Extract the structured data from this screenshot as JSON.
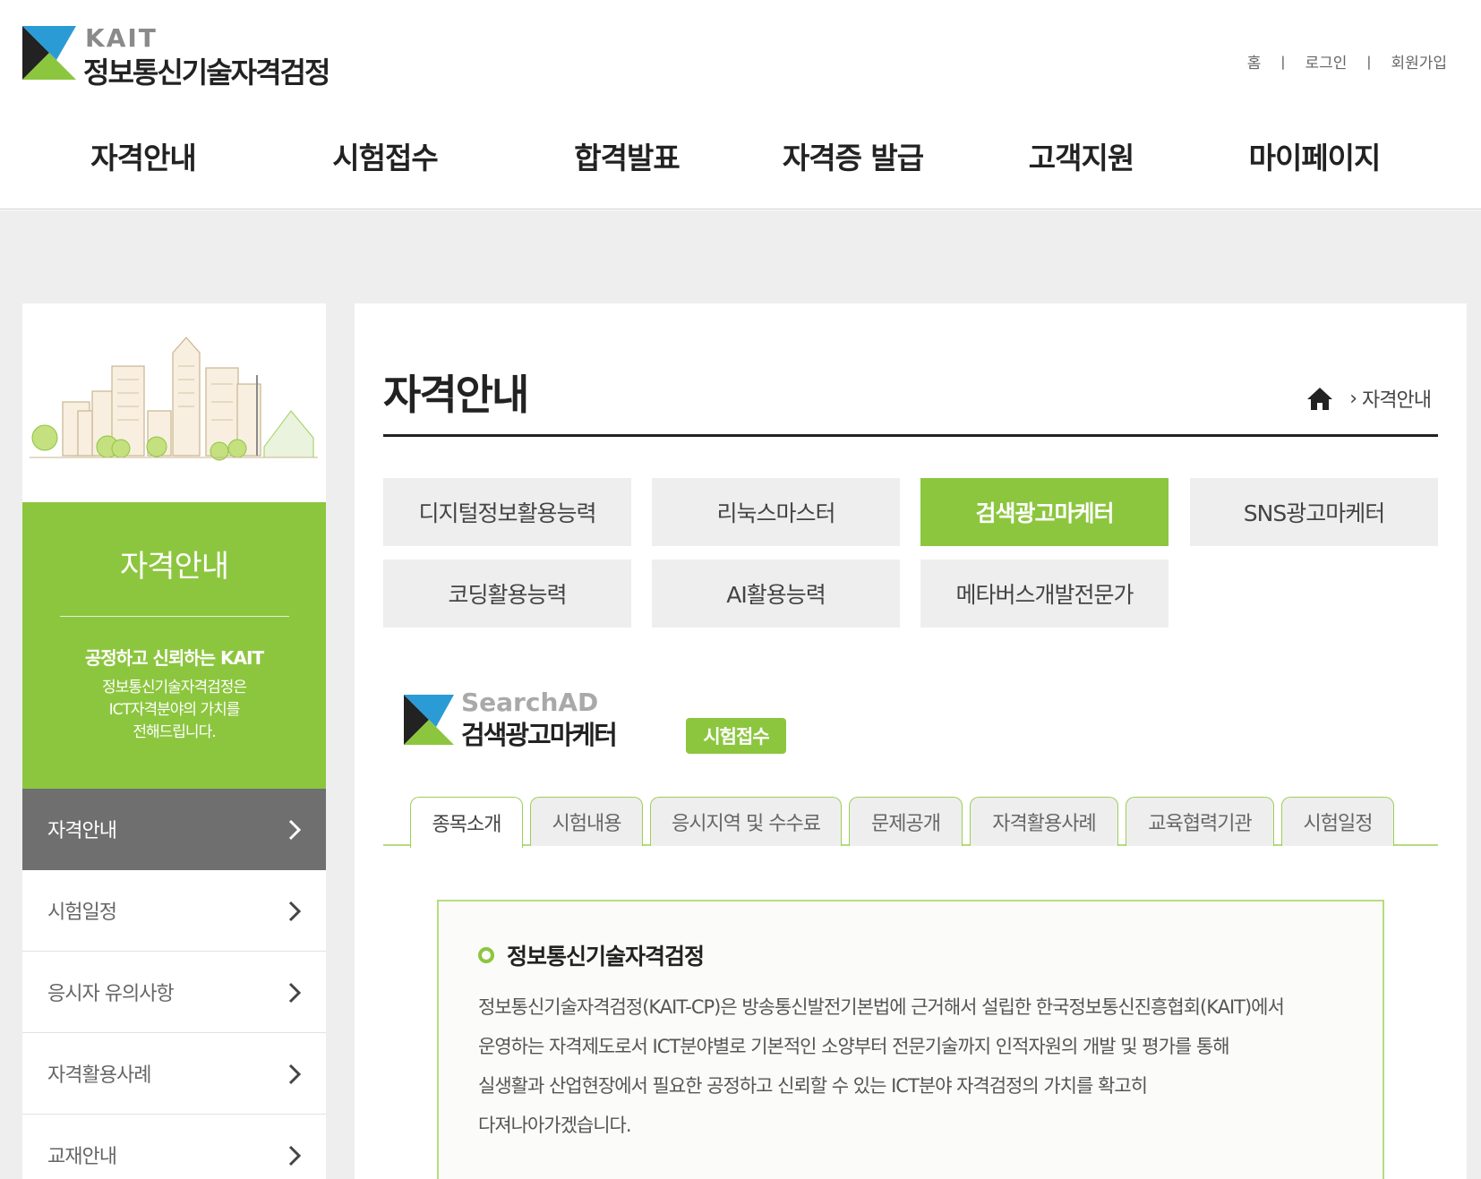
{
  "header": {
    "logo_en": "KAIT",
    "logo_ko": "정보통신기술자격검정",
    "util": [
      "홈",
      "로그인",
      "회원가입"
    ],
    "util_sep": "|",
    "gnb": [
      "자격안내",
      "시험접수",
      "합격발표",
      "자격증 발급",
      "고객지원",
      "마이페이지"
    ]
  },
  "sidebar": {
    "hero_title": "자격안내",
    "slogan": "공정하고 신뢰하는 KAIT",
    "desc1": "정보통신기술자격검정은",
    "desc2": "ICT자격분야의 가치를",
    "desc3": "전해드립니다.",
    "menu": [
      "자격안내",
      "시험일정",
      "응시자 유의사항",
      "자격활용사례",
      "교재안내"
    ],
    "active_index": 0
  },
  "content": {
    "page_title": "자격안내",
    "breadcrumb": "자격안내",
    "certs": [
      "디지털정보활용능력",
      "리눅스마스터",
      "검색광고마케터",
      "SNS광고마케터",
      "코딩활용능력",
      "AI활용능력",
      "메타버스개발전문가"
    ],
    "active_cert_index": 2,
    "brand_en": "SearchAD",
    "brand_ko": "검색광고마케터",
    "brand_badge": "시험접수",
    "tabs": [
      "종목소개",
      "시험내용",
      "응시지역 및 수수료",
      "문제공개",
      "자격활용사례",
      "교육협력기관",
      "시험일정"
    ],
    "active_tab_index": 0,
    "info_title": "정보통신기술자격검정",
    "info_lines": [
      "정보통신기술자격검정(KAIT-CP)은 방송통신발전기본법에 근거해서 설립한 한국정보통신진흥협회(KAIT)에서",
      "운영하는 자격제도로서 ICT분야별로 기본적인 소양부터 전문기술까지 인적자원의 개발 및 평가를 통해",
      "실생활과 산업현장에서 필요한 공정하고 신뢰할 수 있는 ICT분야 자격검정의 가치를 확고히",
      "다져나아가겠습니다."
    ]
  },
  "colors": {
    "brand_green": "#8cc63f",
    "kait_blue": "#2b9bd6",
    "menu_active_bg": "#6f6f6f"
  },
  "icons": [
    "home-icon",
    "chevron-right-icon",
    "kait-logo-icon",
    "searchad-logo-icon"
  ]
}
